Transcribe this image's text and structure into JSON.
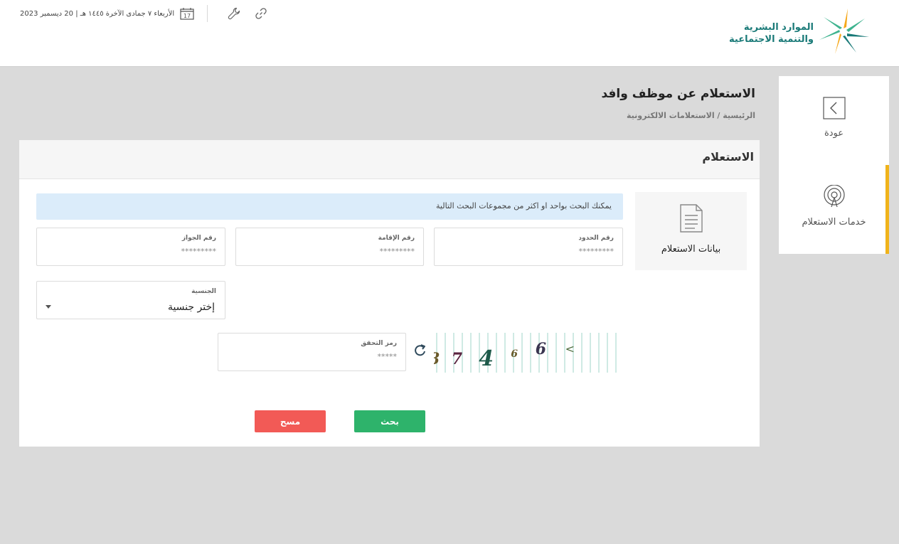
{
  "header": {
    "logo_line1": "الموارد البشرية",
    "logo_line2": "والتنمية الاجتماعية",
    "date": "الأربعاء ٧ جمادى الآخرة ١٤٤٥ هـ | 20 ديسمبر 2023",
    "calendar_day": "17",
    "icons": [
      "calendar-icon",
      "wrench-icon",
      "link-icon"
    ]
  },
  "sidebar": {
    "back_label": "عودة",
    "services_label": "خدمات الاستعلام"
  },
  "page": {
    "title": "الاستعلام عن موظف وافد",
    "breadcrumb": "الرئيسية / الاستعلامات الالكترونية"
  },
  "card": {
    "title": "الاستعلام",
    "data_box_label": "بيانات الاستعلام",
    "notice": "يمكنك البحث بواحد او اكثر من مجموعات البحث التالية"
  },
  "fields": {
    "border_number": {
      "label": "رقم الحدود",
      "placeholder": "*********"
    },
    "iqama_number": {
      "label": "رقم الإقامة",
      "placeholder": "*********"
    },
    "passport_number": {
      "label": "رقم الجواز",
      "placeholder": "*********"
    },
    "nationality": {
      "label": "الجنسية",
      "value": "إختر جنسية"
    },
    "captcha": {
      "label": "رمز التحقق",
      "placeholder": "*****"
    }
  },
  "captcha_chars": [
    "8",
    "7",
    "4",
    "6",
    "6",
    ">"
  ],
  "buttons": {
    "search": "بحث",
    "clear": "مسح"
  },
  "colors": {
    "teal": "#1a7a78",
    "accent": "#f0b31b",
    "search_btn": "#2eb36b",
    "clear_btn": "#f25a56",
    "notice_bg": "#dbecfa"
  }
}
